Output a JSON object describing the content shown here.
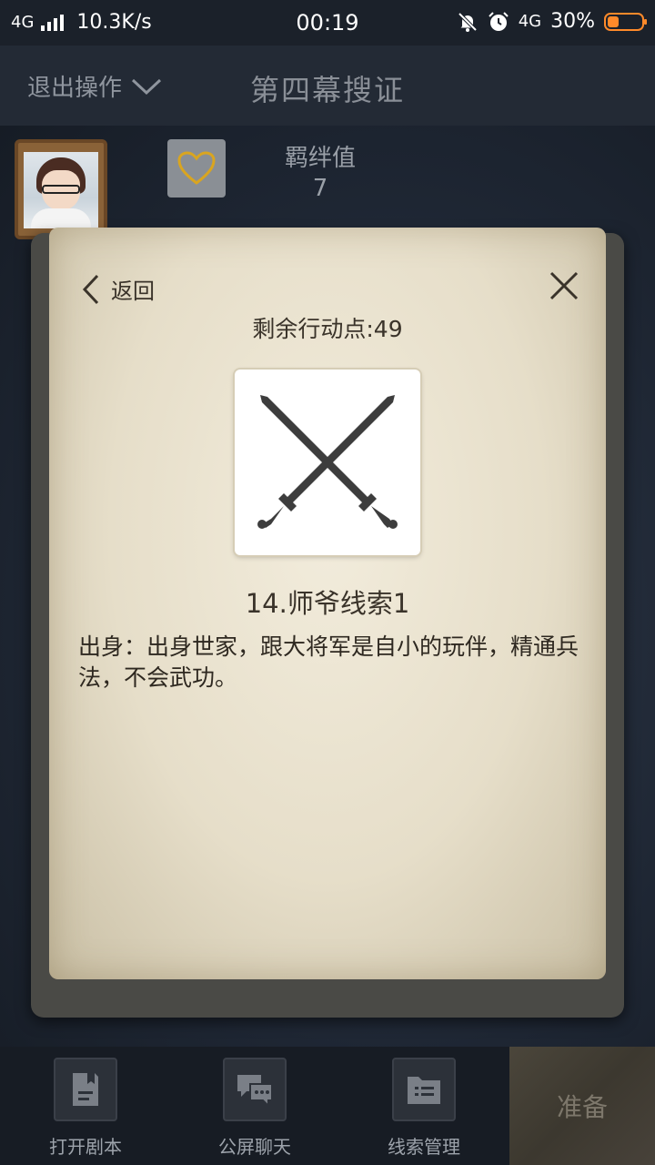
{
  "status_bar": {
    "network": "4G",
    "speed": "10.3K/s",
    "time": "00:19",
    "network_right": "4G",
    "battery": "30%",
    "battery_level": 0.3,
    "battery_color": "#ff8a2a",
    "icons": [
      "signal-icon",
      "mute-bell-icon",
      "alarm-icon",
      "battery-icon"
    ]
  },
  "header": {
    "exit_label": "退出操作",
    "title": "第四幕搜证"
  },
  "player": {
    "bond_label": "羁绊值",
    "bond_value": "7"
  },
  "dialog": {
    "back_label": "返回",
    "action_points": "剩余行动点:49",
    "clue_image_icon": "crossed-swords-icon",
    "clue_title": "14.师爷线索1",
    "clue_description": "出身：出身世家，跟大将军是自小的玩伴，精通兵法，不会武功。"
  },
  "bottom_nav": {
    "items": [
      {
        "label": "打开剧本",
        "icon": "script-book-icon"
      },
      {
        "label": "公屏聊天",
        "icon": "chat-icon"
      },
      {
        "label": "线索管理",
        "icon": "clue-list-icon"
      }
    ],
    "ready_label": "准备"
  }
}
